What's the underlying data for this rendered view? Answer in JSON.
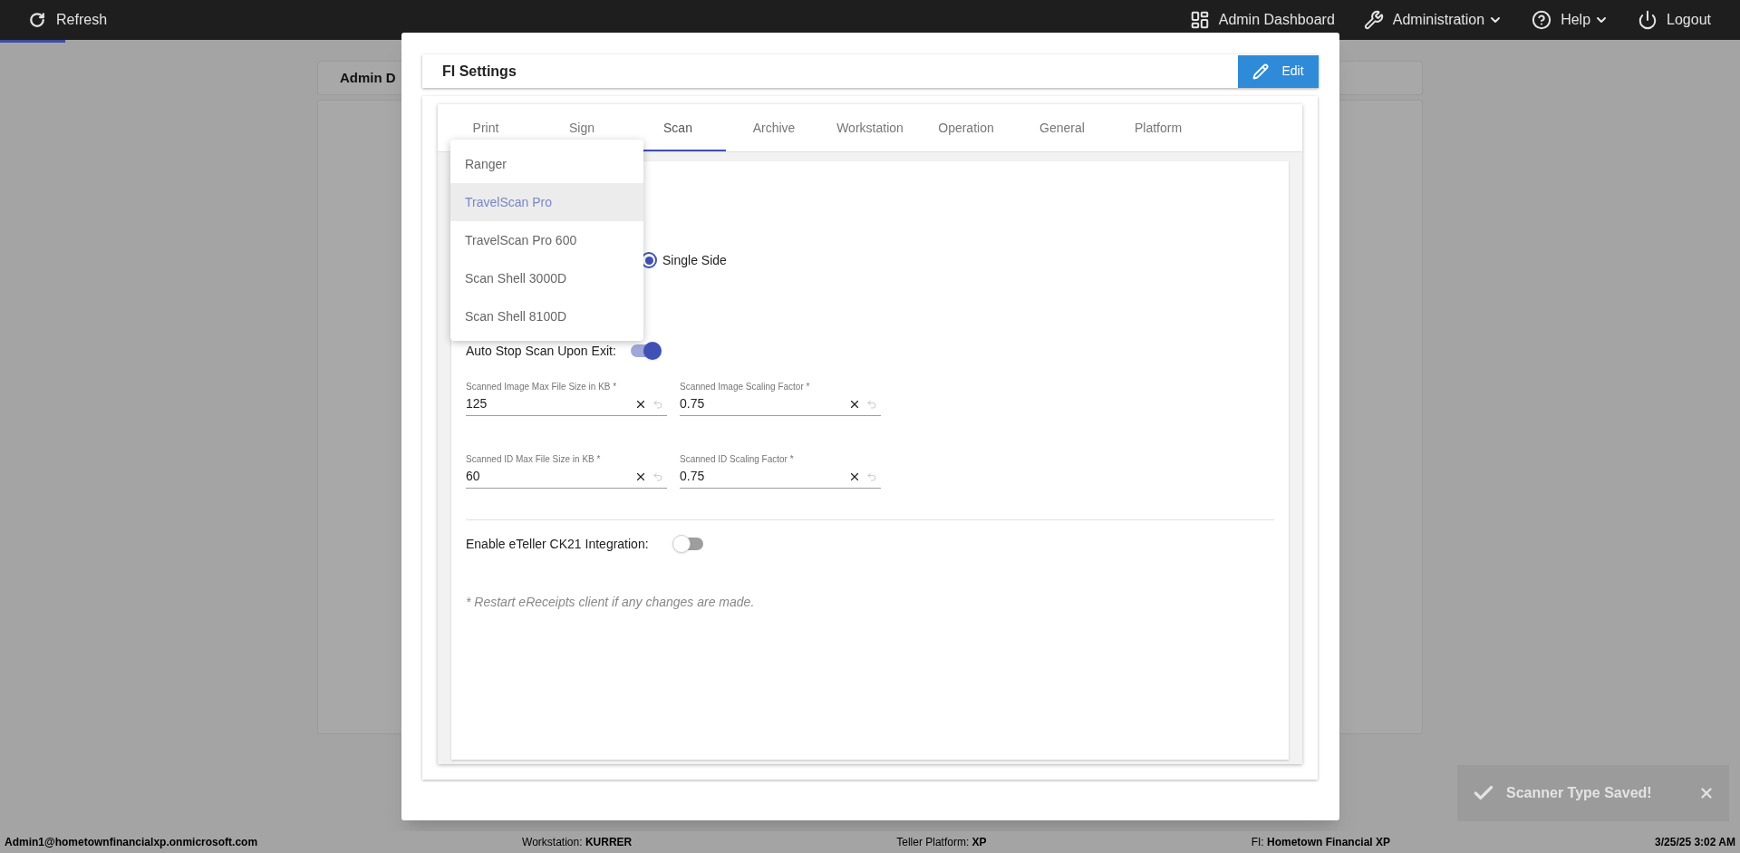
{
  "top_bar": {
    "refresh": "Refresh",
    "nav": [
      {
        "label": "Admin Dashboard",
        "caret": false
      },
      {
        "label": "Administration",
        "caret": true
      },
      {
        "label": "Help",
        "caret": true
      },
      {
        "label": "Logout",
        "caret": false
      }
    ]
  },
  "background_panel": {
    "tab_label": "Admin D"
  },
  "dialog": {
    "title": "FI Settings",
    "edit_button": "Edit",
    "tabs": [
      {
        "label": "Print",
        "selected": false
      },
      {
        "label": "Sign",
        "selected": false
      },
      {
        "label": "Scan",
        "selected": true
      },
      {
        "label": "Archive",
        "selected": false
      },
      {
        "label": "Workstation",
        "selected": false
      },
      {
        "label": "Operation",
        "selected": false
      },
      {
        "label": "General",
        "selected": false
      },
      {
        "label": "Platform",
        "selected": false
      }
    ],
    "scanner_type_menu": [
      {
        "label": "Ranger",
        "selected": false
      },
      {
        "label": "TravelScan Pro",
        "selected": true
      },
      {
        "label": "TravelScan Pro 600",
        "selected": false
      },
      {
        "label": "Scan Shell 3000D",
        "selected": false
      },
      {
        "label": "Scan Shell 8100D",
        "selected": false
      }
    ],
    "scan_mode_options": [
      {
        "label": "Single Side",
        "selected": true
      }
    ],
    "auto_stop": {
      "label": "Auto Stop Scan Upon Exit:",
      "on": true
    },
    "fields": [
      {
        "label": "Scanned Image Max File Size in KB *",
        "value": "125"
      },
      {
        "label": "Scanned Image Scaling Factor *",
        "value": "0.75"
      },
      {
        "label": "Scanned ID Max File Size in KB *",
        "value": "60"
      },
      {
        "label": "Scanned ID Scaling Factor *",
        "value": "0.75"
      }
    ],
    "eteller": {
      "label": "Enable eTeller CK21 Integration:",
      "on": false
    },
    "note": "* Restart eReceipts client if any changes are made."
  },
  "toast": {
    "message": "Scanner Type Saved!"
  },
  "status_bar": {
    "user": "Admin1@hometownfinancialxp.onmicrosoft.com",
    "items": [
      {
        "label": "Workstation: ",
        "value": "KURRER"
      },
      {
        "label": "Teller Platform: ",
        "value": "XP"
      },
      {
        "label": "FI: ",
        "value": "Hometown Financial XP"
      }
    ],
    "datetime": "3/25/25 3:02 AM"
  }
}
